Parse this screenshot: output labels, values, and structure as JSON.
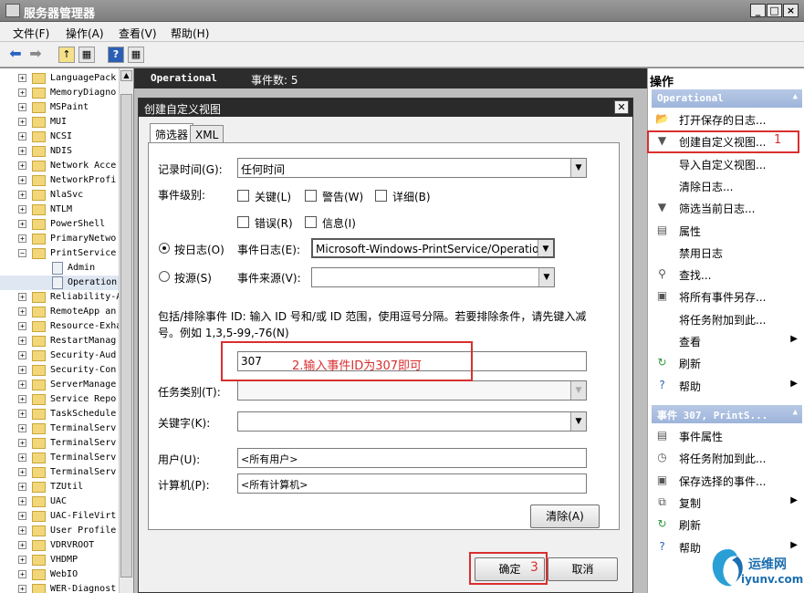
{
  "window": {
    "title": "服务器管理器",
    "controls": [
      "_",
      "□",
      "×"
    ]
  },
  "menu": [
    "文件(F)",
    "操作(A)",
    "查看(V)",
    "帮助(H)"
  ],
  "toolbar": {
    "icons": [
      "back-icon",
      "forward-icon",
      "up-folder-icon",
      "show-hide-tree-icon",
      "help-icon",
      "show-hide-actions-icon"
    ]
  },
  "tree": {
    "items": [
      {
        "exp": "+",
        "label": "LanguagePack"
      },
      {
        "exp": "+",
        "label": "MemoryDiagno"
      },
      {
        "exp": "+",
        "label": "MSPaint"
      },
      {
        "exp": "+",
        "label": "MUI"
      },
      {
        "exp": "+",
        "label": "NCSI"
      },
      {
        "exp": "+",
        "label": "NDIS"
      },
      {
        "exp": "+",
        "label": "Network Acce"
      },
      {
        "exp": "+",
        "label": "NetworkProfi"
      },
      {
        "exp": "+",
        "label": "NlaSvc"
      },
      {
        "exp": "+",
        "label": "NTLM"
      },
      {
        "exp": "+",
        "label": "PowerShell"
      },
      {
        "exp": "+",
        "label": "PrimaryNetwo"
      },
      {
        "exp": "−",
        "label": "PrintService"
      },
      {
        "exp": "",
        "label": "Admin",
        "child": true
      },
      {
        "exp": "",
        "label": "Operation",
        "child": true,
        "selected": true
      },
      {
        "exp": "+",
        "label": "Reliability-A"
      },
      {
        "exp": "+",
        "label": "RemoteApp an"
      },
      {
        "exp": "+",
        "label": "Resource-Exha"
      },
      {
        "exp": "+",
        "label": "RestartManag"
      },
      {
        "exp": "+",
        "label": "Security-Aud"
      },
      {
        "exp": "+",
        "label": "Security-Con"
      },
      {
        "exp": "+",
        "label": "ServerManage"
      },
      {
        "exp": "+",
        "label": "Service Repo"
      },
      {
        "exp": "+",
        "label": "TaskSchedule"
      },
      {
        "exp": "+",
        "label": "TerminalServ"
      },
      {
        "exp": "+",
        "label": "TerminalServ"
      },
      {
        "exp": "+",
        "label": "TerminalServ"
      },
      {
        "exp": "+",
        "label": "TerminalServ"
      },
      {
        "exp": "+",
        "label": "TZUtil"
      },
      {
        "exp": "+",
        "label": "UAC"
      },
      {
        "exp": "+",
        "label": "UAC-FileVirt"
      },
      {
        "exp": "+",
        "label": "User Profile"
      },
      {
        "exp": "+",
        "label": "VDRVROOT"
      },
      {
        "exp": "+",
        "label": "VHDMP"
      },
      {
        "exp": "+",
        "label": "WebIO"
      },
      {
        "exp": "+",
        "label": "WER-Diagnost"
      }
    ]
  },
  "middle": {
    "log_name": "Operational",
    "event_count": "事件数: 5"
  },
  "dialog": {
    "title": "创建自定义视图",
    "tabs": [
      "筛选器",
      "XML"
    ],
    "logged_label": "记录时间(G):",
    "logged_value": "任何时间",
    "level_label": "事件级别:",
    "levels": [
      "关键(L)",
      "警告(W)",
      "详细(B)",
      "错误(R)",
      "信息(I)"
    ],
    "by_log_label": "按日志(O)",
    "event_log_label": "事件日志(E):",
    "event_log_value": "Microsoft-Windows-PrintService/Operational",
    "by_source_label": "按源(S)",
    "event_source_label": "事件来源(V):",
    "id_help_line1": "包括/排除事件 ID: 输入 ID 号和/或 ID 范围，使用逗号分隔。若要排除条件，请先键入减",
    "id_help_line2": "号。例如 1,3,5-99,-76(N)",
    "event_id_value": "307",
    "task_category_label": "任务类别(T):",
    "keywords_label": "关键字(K):",
    "user_label": "用户(U):",
    "user_value": "<所有用户>",
    "computer_label": "计算机(P):",
    "computer_value": "<所有计算机>",
    "clear_button": "清除(A)",
    "ok_button": "确定",
    "cancel_button": "取消"
  },
  "annotations": {
    "note1": "1",
    "note2": "2.输入事件ID为307即可",
    "note3": "3",
    "color": "#d92f2f"
  },
  "actions": {
    "title": "操作",
    "section1": "Operational",
    "items1": [
      {
        "icon": "folder-open-icon",
        "glyph": "📂",
        "label": "打开保存的日志...",
        "arrow": ""
      },
      {
        "icon": "filter-icon",
        "glyph": "▼",
        "label": "创建自定义视图...",
        "arrow": ""
      },
      {
        "icon": "",
        "glyph": "",
        "label": "导入自定义视图...",
        "arrow": ""
      },
      {
        "icon": "",
        "glyph": "",
        "label": "清除日志...",
        "arrow": ""
      },
      {
        "icon": "filter-icon",
        "glyph": "▼",
        "label": "筛选当前日志...",
        "arrow": ""
      },
      {
        "icon": "properties-icon",
        "glyph": "▤",
        "label": "属性",
        "arrow": ""
      },
      {
        "icon": "",
        "glyph": "",
        "label": "禁用日志",
        "arrow": ""
      },
      {
        "icon": "find-icon",
        "glyph": "⚲",
        "label": "查找...",
        "arrow": ""
      },
      {
        "icon": "save-icon",
        "glyph": "▣",
        "label": "将所有事件另存...",
        "arrow": ""
      },
      {
        "icon": "",
        "glyph": "",
        "label": "将任务附加到此...",
        "arrow": ""
      },
      {
        "icon": "",
        "glyph": "",
        "label": "查看",
        "arrow": "▶"
      },
      {
        "icon": "refresh-icon",
        "glyph": "↻",
        "label": "刷新",
        "arrow": ""
      },
      {
        "icon": "help-icon",
        "glyph": "?",
        "label": "帮助",
        "arrow": "▶"
      }
    ],
    "section2": "事件 307, PrintS...",
    "items2": [
      {
        "icon": "event-properties-icon",
        "glyph": "▤",
        "label": "事件属性",
        "arrow": ""
      },
      {
        "icon": "attach-task-icon",
        "glyph": "◷",
        "label": "将任务附加到此...",
        "arrow": ""
      },
      {
        "icon": "save-icon",
        "glyph": "▣",
        "label": "保存选择的事件...",
        "arrow": ""
      },
      {
        "icon": "copy-icon",
        "glyph": "⧉",
        "label": "复制",
        "arrow": "▶"
      },
      {
        "icon": "refresh-icon",
        "glyph": "↻",
        "label": "刷新",
        "arrow": ""
      },
      {
        "icon": "help-icon",
        "glyph": "?",
        "label": "帮助",
        "arrow": "▶"
      }
    ]
  },
  "watermark": {
    "line1": "运维网",
    "line2": "iyunv.com"
  }
}
